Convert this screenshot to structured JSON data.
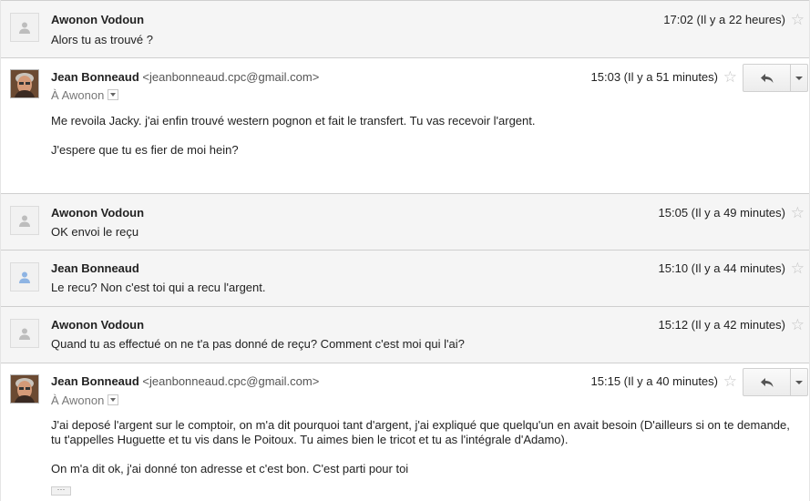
{
  "messages": [
    {
      "sender": "Awonon Vodoun",
      "snippet": "Alors tu as trouvé ?",
      "time": "17:02 (Il y a 22 heures)"
    },
    {
      "sender": "Jean Bonneaud",
      "email": "<jeanbonneaud.cpc@gmail.com>",
      "to": "À Awonon",
      "time": "15:03 (Il y a 51 minutes)",
      "body": [
        "Me revoila Jacky. j'ai enfin trouvé western pognon et fait le transfert. Tu vas recevoir l'argent.",
        "J'espere que tu es fier de moi hein?"
      ]
    },
    {
      "sender": "Awonon Vodoun",
      "snippet": "OK envoi le reçu",
      "time": "15:05 (Il y a 49 minutes)"
    },
    {
      "sender": "Jean Bonneaud",
      "snippet": "Le recu? Non c'est toi qui a recu l'argent.",
      "time": "15:10 (Il y a 44 minutes)"
    },
    {
      "sender": "Awonon Vodoun",
      "snippet": "Quand tu as effectué on ne t'a pas donné de reçu? Comment c'est moi qui l'ai?",
      "time": "15:12 (Il y a 42 minutes)"
    },
    {
      "sender": "Jean Bonneaud",
      "email": "<jeanbonneaud.cpc@gmail.com>",
      "to": "À Awonon",
      "time": "15:15 (Il y a 40 minutes)",
      "body": [
        "J'ai deposé l'argent sur le comptoir, on m'a dit pourquoi tant d'argent, j'ai expliqué que quelqu'un en avait besoin (D'ailleurs si on te demande, tu t'appelles Huguette et tu vis dans le Poitoux. Tu aimes bien le tricot et tu as l'intégrale d'Adamo).",
        "On m'a dit ok, j'ai donné ton adresse et c'est bon. C'est parti pour toi"
      ]
    }
  ],
  "icons": {
    "star": "star-icon",
    "reply": "reply-icon",
    "more": "more-options-icon",
    "avatar": "default-avatar-icon"
  },
  "ellipsis_label": "···"
}
